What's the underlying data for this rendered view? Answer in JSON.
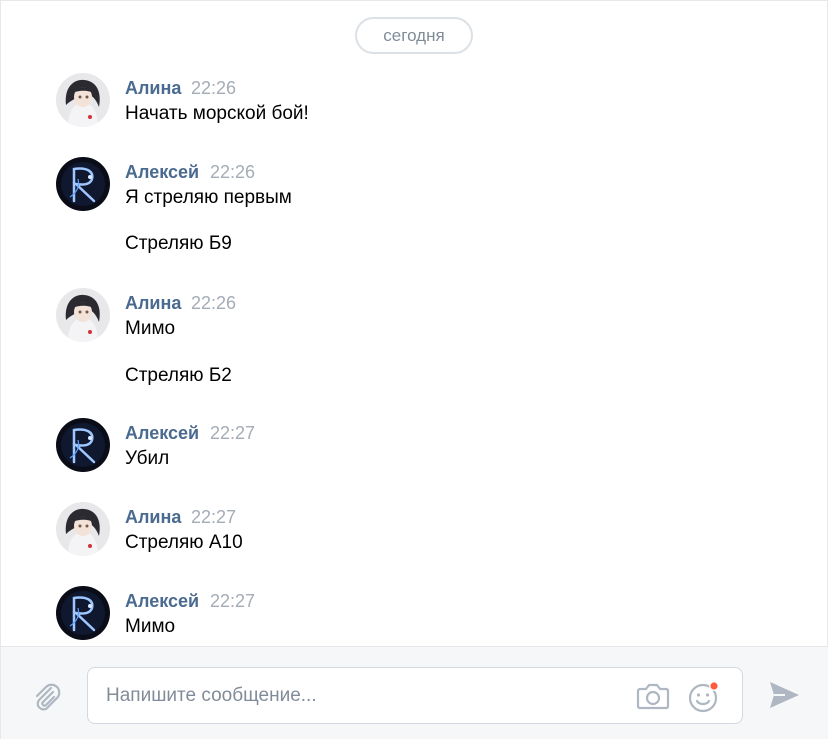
{
  "chat": {
    "date_divider": "сегодня",
    "messages": [
      {
        "author": "Алина",
        "time": "22:26",
        "avatar": "alina-avatar",
        "lines": [
          "Начать морской бой!"
        ]
      },
      {
        "author": "Алексей",
        "time": "22:26",
        "avatar": "aleksey-avatar",
        "lines": [
          "Я стреляю первым",
          "Стреляю Б9"
        ]
      },
      {
        "author": "Алина",
        "time": "22:26",
        "avatar": "alina-avatar",
        "lines": [
          "Мимо",
          "Стреляю Б2"
        ]
      },
      {
        "author": "Алексей",
        "time": "22:27",
        "avatar": "aleksey-avatar",
        "lines": [
          "Убил"
        ]
      },
      {
        "author": "Алина",
        "time": "22:27",
        "avatar": "alina-avatar",
        "lines": [
          "Стреляю А10"
        ]
      },
      {
        "author": "Алексей",
        "time": "22:27",
        "avatar": "aleksey-avatar",
        "lines": [
          "Мимо"
        ]
      }
    ]
  },
  "composer": {
    "placeholder": "Напишите сообщение...",
    "icons": {
      "attach": "paperclip-icon",
      "camera": "camera-icon",
      "emoji": "emoji-icon",
      "send": "send-icon"
    },
    "emoji_notification_color": "#ff5c3c"
  },
  "colors": {
    "author_name": "#4a6a8f",
    "timestamp": "#a4acb6",
    "icon_gray": "#aeb7c2"
  }
}
